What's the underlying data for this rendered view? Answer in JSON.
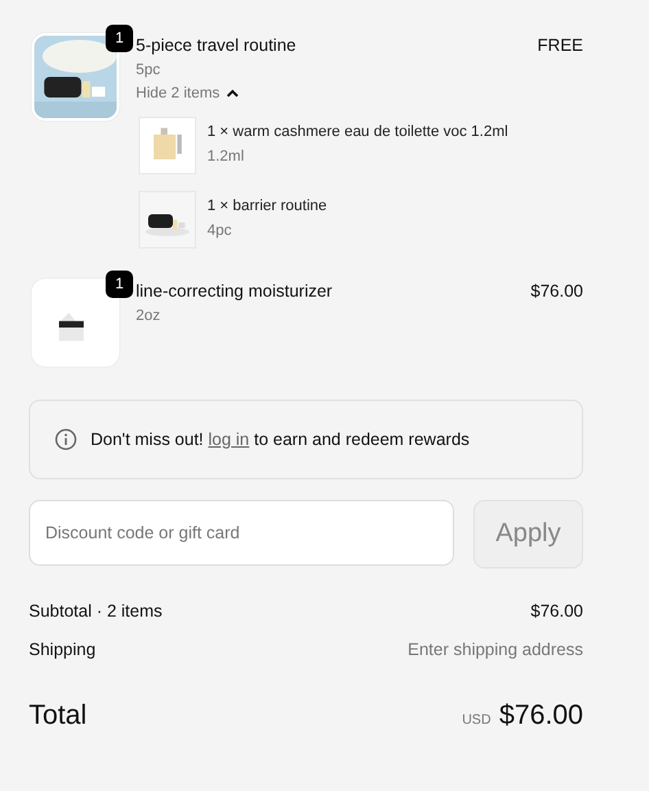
{
  "line_items": [
    {
      "quantity": "1",
      "name": "5-piece travel routine",
      "variant": "5pc",
      "price": "FREE",
      "toggle": {
        "label": "Hide 2 items",
        "expanded": true
      },
      "components": [
        {
          "name": "1 × warm cashmere eau de toilette voc 1.2ml",
          "variant": "1.2ml"
        },
        {
          "name": "1 × barrier routine",
          "variant": "4pc"
        }
      ]
    },
    {
      "quantity": "1",
      "name": "line-correcting moisturizer",
      "variant": "2oz",
      "price": "$76.00"
    }
  ],
  "notice": {
    "lead": "Don't miss out!",
    "link": "log in",
    "text": "to earn and redeem rewards"
  },
  "discount": {
    "placeholder": "Discount code or gift card",
    "button": "Apply",
    "disabled": true
  },
  "summary": {
    "subtotal_label": "Subtotal · 2 items",
    "subtotal": "$76.00",
    "shipping_label": "Shipping",
    "shipping": "Enter shipping address",
    "total_label": "Total",
    "currency": "USD",
    "total": "$76.00"
  }
}
